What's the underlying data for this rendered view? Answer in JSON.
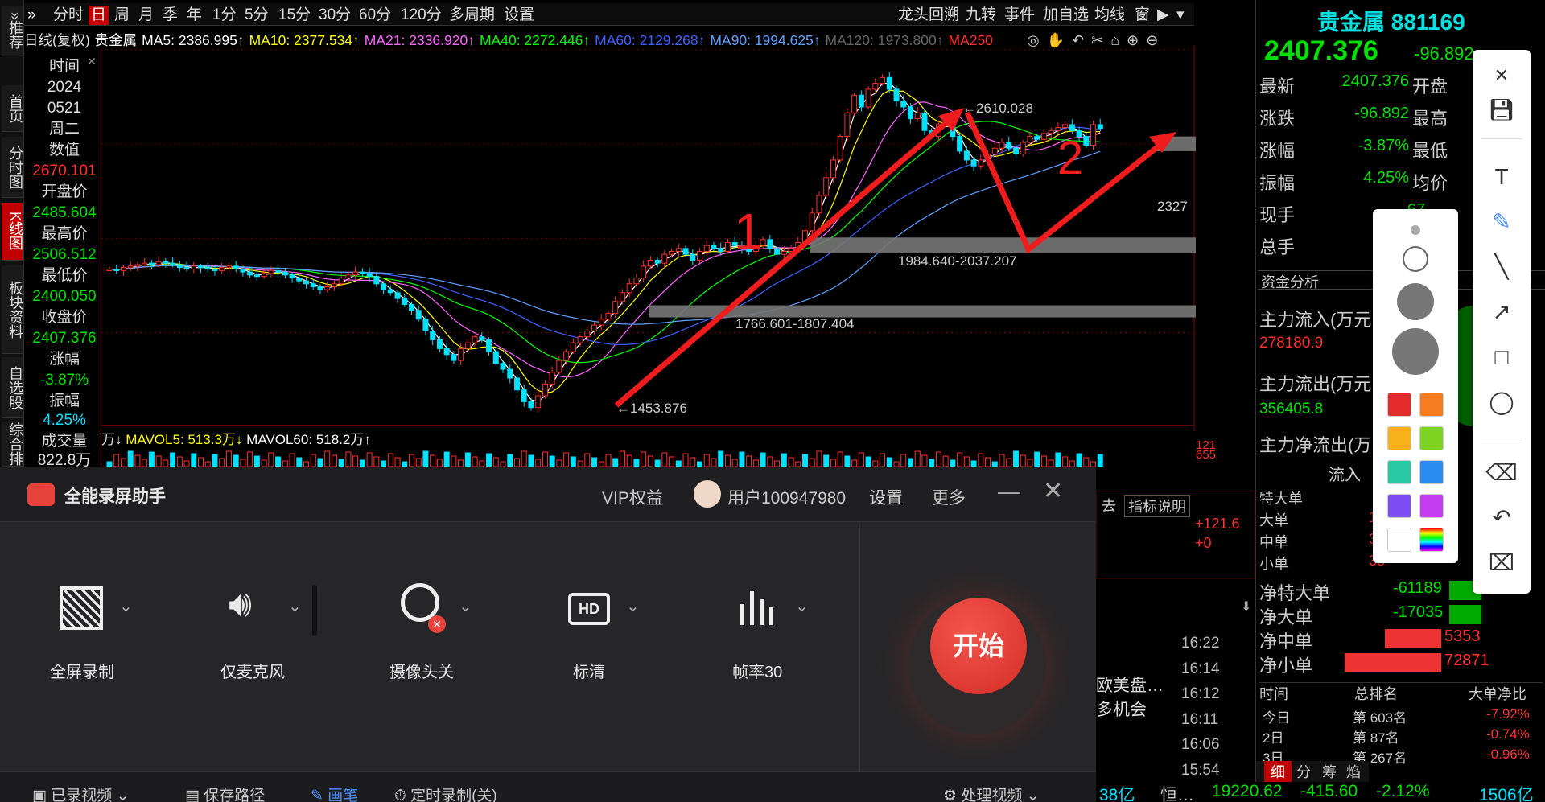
{
  "leftnav": [
    {
      "label": "»推荐"
    },
    {
      "label": "首页"
    },
    {
      "label": "分时图"
    },
    {
      "label": "K线图"
    },
    {
      "label": "板块资料"
    },
    {
      "label": "自选股"
    },
    {
      "label": "综合排"
    }
  ],
  "toolbar": {
    "periods": [
      "分时",
      "日",
      "周",
      "月",
      "季",
      "年",
      "1分",
      "5分",
      "15分",
      "30分",
      "60分",
      "120分",
      "多周期",
      "设置"
    ],
    "right": [
      "龙头回溯",
      "九转",
      "事件",
      "加自选",
      "均线",
      "窗"
    ]
  },
  "maline": {
    "head": "日线(复权)",
    "name": "贵金属",
    "ma5": "MA5: 2386.995↑",
    "ma10": "MA10: 2377.534↑",
    "ma21": "MA21: 2336.920↑",
    "ma40": "MA40: 2272.446↑",
    "ma60": "MA60: 2129.268↑",
    "ma90": "MA90: 1994.625↑",
    "ma120": "MA120: 1973.800↑",
    "ma250": "MA250"
  },
  "info": {
    "time_label": "时间",
    "year": "2024",
    "date": "0521",
    "weekday": "周二",
    "value_label": "数值",
    "value": "2670.101",
    "open_label": "开盘价",
    "open": "2485.604",
    "high_label": "最高价",
    "high": "2506.512",
    "low_label": "最低价",
    "low": "2400.050",
    "close_label": "收盘价",
    "close": "2407.376",
    "chg_label": "涨幅",
    "chg": "-3.87%",
    "amp_label": "振幅",
    "amp": "4.25%",
    "vol_label": "成交量",
    "vol": "822.8万"
  },
  "chart_data": {
    "type": "candlestick",
    "y_ticks": [
      "2674",
      "2354",
      "2034",
      "1714"
    ],
    "ylim": [
      1380,
      2690
    ],
    "annotations": {
      "peak": "2610.028",
      "trough": "1453.876",
      "last": "2327",
      "box1": "1984.640-2037.207",
      "box2": "1766.601-1807.404",
      "label1": "1",
      "label2": "2"
    },
    "closes": [
      1930,
      1925,
      1935,
      1940,
      1945,
      1950,
      1945,
      1955,
      1950,
      1945,
      1935,
      1930,
      1940,
      1935,
      1930,
      1925,
      1935,
      1940,
      1930,
      1920,
      1910,
      1905,
      1915,
      1925,
      1920,
      1910,
      1900,
      1890,
      1880,
      1870,
      1860,
      1870,
      1880,
      1900,
      1910,
      1920,
      1915,
      1905,
      1880,
      1860,
      1850,
      1830,
      1810,
      1790,
      1760,
      1720,
      1690,
      1660,
      1640,
      1620,
      1660,
      1680,
      1700,
      1690,
      1650,
      1610,
      1590,
      1560,
      1520,
      1480,
      1460,
      1500,
      1540,
      1580,
      1620,
      1650,
      1680,
      1700,
      1720,
      1740,
      1760,
      1780,
      1820,
      1850,
      1880,
      1900,
      1940,
      1960,
      1950,
      1980,
      1990,
      2000,
      1980,
      1960,
      1990,
      2010,
      2000,
      1990,
      2020,
      2010,
      2000,
      1990,
      2010,
      2030,
      2000,
      1980,
      1990,
      2000,
      2020,
      2060,
      2120,
      2180,
      2240,
      2300,
      2380,
      2460,
      2520,
      2480,
      2540,
      2560,
      2580,
      2540,
      2500,
      2480,
      2440,
      2460,
      2400,
      2380,
      2420,
      2440,
      2380,
      2330,
      2300,
      2280,
      2300,
      2320,
      2340,
      2360,
      2340,
      2320,
      2360,
      2380,
      2370,
      2390,
      2400,
      2410,
      2420,
      2400,
      2380,
      2350,
      2420,
      2407
    ],
    "volume_labels": {
      "mavol5": "MAVOL5: 513.3万↓",
      "mavol60": "MAVOL60: 518.2万↑",
      "unit": "万↓",
      "ticks": [
        "121",
        "655"
      ]
    }
  },
  "rpanel": {
    "title": "贵金属 881169",
    "price": "2407.376",
    "change": "-96.892",
    "rows": [
      {
        "k": "最新",
        "v": "2407.376",
        "k2": "开盘"
      },
      {
        "k": "涨跌",
        "v": "-96.892",
        "k2": "最高"
      },
      {
        "k": "涨幅",
        "v": "-3.87%",
        "k2": "最低"
      },
      {
        "k": "振幅",
        "v": "4.25%",
        "k2": "均价"
      },
      {
        "k": "现手",
        "v": "67",
        "k2": ""
      },
      {
        "k": "总手",
        "v": "822.",
        "k2": ""
      }
    ],
    "fund_title": "资金分析",
    "in_label": "主力流入(万元",
    "in_val": "278180.9",
    "out_label": "主力流出(万元",
    "out_val": "356405.8",
    "net_label": "主力净流出(万",
    "flow_header": "流入",
    "orders": [
      {
        "k": "特大单",
        "v": "9"
      },
      {
        "k": "大单",
        "v": "18"
      },
      {
        "k": "中单",
        "v": "36"
      },
      {
        "k": "小单",
        "v": "38"
      }
    ],
    "nets": [
      {
        "k": "净特大单",
        "v": "-61189"
      },
      {
        "k": "净大单",
        "v": "-17035"
      },
      {
        "k": "净中单",
        "v": "5353"
      },
      {
        "k": "净小单",
        "v": "72871"
      }
    ],
    "rank_head": [
      "时间",
      "总排名",
      "大单净比"
    ],
    "ranks": [
      {
        "t": "今日",
        "r": "第 603名",
        "p": "-7.92%"
      },
      {
        "t": "2日",
        "r": "第 87名",
        "p": "-0.74%"
      },
      {
        "t": "3日",
        "r": "第 267名",
        "p": "-0.96%"
      }
    ],
    "bottom_tabs": [
      "细",
      "分",
      "筹",
      "焰"
    ],
    "pct_labels": [
      "89",
      "%"
    ]
  },
  "midright": {
    "tabs": [
      "去",
      "指标说明"
    ],
    "vals": [
      "+121.6",
      "+0"
    ],
    "times": [
      "16:22",
      "16:14",
      "16:12",
      "16:11",
      "16:06",
      "15:54"
    ],
    "news": [
      "欧美盘…",
      "多机会"
    ]
  },
  "statusbar": {
    "a": "38亿",
    "b": "恒…",
    "c": "19220.62",
    "d": "-415.60",
    "e": "-2.12%",
    "f": "1506亿"
  },
  "recorder": {
    "app_name": "全能录屏助手",
    "vip": "VIP权益",
    "user": "用户100947980",
    "settings": "设置",
    "more": "更多",
    "tools": [
      {
        "icon": "fullscreen-icon",
        "label": "全屏录制"
      },
      {
        "icon": "speaker-icon",
        "label": "仅麦克风"
      },
      {
        "icon": "camera-icon",
        "label": "摄像头关"
      },
      {
        "icon": "hd-icon",
        "label": "标清"
      },
      {
        "icon": "framerate-icon",
        "label": "帧率30"
      }
    ],
    "start": "开始",
    "bottom": [
      "已录视频",
      "保存路径",
      "画笔",
      "定时录制(关)",
      "处理视频"
    ]
  },
  "colors": {
    "up": "#ff3030",
    "down": "#00e0ff",
    "ma5": "#ffffff",
    "ma10": "#ffff00",
    "ma21": "#ff66ff",
    "ma40": "#00ff00",
    "ma60": "#4060ff",
    "ma90": "#60a0ff",
    "arrow": "#ee1c1c"
  }
}
